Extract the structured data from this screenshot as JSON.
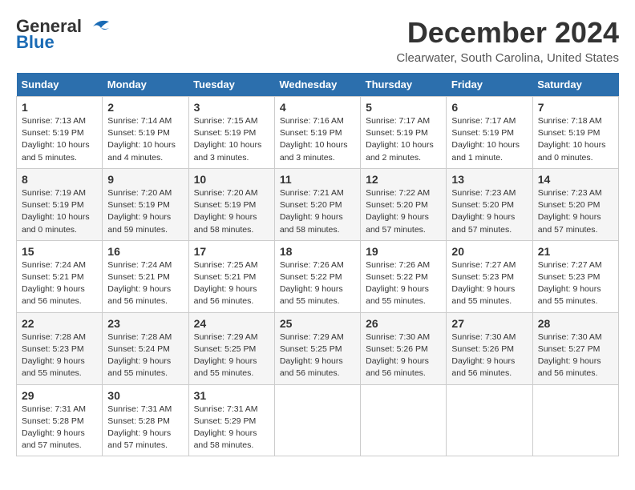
{
  "header": {
    "logo_line1": "General",
    "logo_line2": "Blue",
    "month_title": "December 2024",
    "location": "Clearwater, South Carolina, United States"
  },
  "columns": [
    "Sunday",
    "Monday",
    "Tuesday",
    "Wednesday",
    "Thursday",
    "Friday",
    "Saturday"
  ],
  "weeks": [
    [
      {
        "day": "1",
        "info": "Sunrise: 7:13 AM\nSunset: 5:19 PM\nDaylight: 10 hours\nand 5 minutes."
      },
      {
        "day": "2",
        "info": "Sunrise: 7:14 AM\nSunset: 5:19 PM\nDaylight: 10 hours\nand 4 minutes."
      },
      {
        "day": "3",
        "info": "Sunrise: 7:15 AM\nSunset: 5:19 PM\nDaylight: 10 hours\nand 3 minutes."
      },
      {
        "day": "4",
        "info": "Sunrise: 7:16 AM\nSunset: 5:19 PM\nDaylight: 10 hours\nand 3 minutes."
      },
      {
        "day": "5",
        "info": "Sunrise: 7:17 AM\nSunset: 5:19 PM\nDaylight: 10 hours\nand 2 minutes."
      },
      {
        "day": "6",
        "info": "Sunrise: 7:17 AM\nSunset: 5:19 PM\nDaylight: 10 hours\nand 1 minute."
      },
      {
        "day": "7",
        "info": "Sunrise: 7:18 AM\nSunset: 5:19 PM\nDaylight: 10 hours\nand 0 minutes."
      }
    ],
    [
      {
        "day": "8",
        "info": "Sunrise: 7:19 AM\nSunset: 5:19 PM\nDaylight: 10 hours\nand 0 minutes."
      },
      {
        "day": "9",
        "info": "Sunrise: 7:20 AM\nSunset: 5:19 PM\nDaylight: 9 hours\nand 59 minutes."
      },
      {
        "day": "10",
        "info": "Sunrise: 7:20 AM\nSunset: 5:19 PM\nDaylight: 9 hours\nand 58 minutes."
      },
      {
        "day": "11",
        "info": "Sunrise: 7:21 AM\nSunset: 5:20 PM\nDaylight: 9 hours\nand 58 minutes."
      },
      {
        "day": "12",
        "info": "Sunrise: 7:22 AM\nSunset: 5:20 PM\nDaylight: 9 hours\nand 57 minutes."
      },
      {
        "day": "13",
        "info": "Sunrise: 7:23 AM\nSunset: 5:20 PM\nDaylight: 9 hours\nand 57 minutes."
      },
      {
        "day": "14",
        "info": "Sunrise: 7:23 AM\nSunset: 5:20 PM\nDaylight: 9 hours\nand 57 minutes."
      }
    ],
    [
      {
        "day": "15",
        "info": "Sunrise: 7:24 AM\nSunset: 5:21 PM\nDaylight: 9 hours\nand 56 minutes."
      },
      {
        "day": "16",
        "info": "Sunrise: 7:24 AM\nSunset: 5:21 PM\nDaylight: 9 hours\nand 56 minutes."
      },
      {
        "day": "17",
        "info": "Sunrise: 7:25 AM\nSunset: 5:21 PM\nDaylight: 9 hours\nand 56 minutes."
      },
      {
        "day": "18",
        "info": "Sunrise: 7:26 AM\nSunset: 5:22 PM\nDaylight: 9 hours\nand 55 minutes."
      },
      {
        "day": "19",
        "info": "Sunrise: 7:26 AM\nSunset: 5:22 PM\nDaylight: 9 hours\nand 55 minutes."
      },
      {
        "day": "20",
        "info": "Sunrise: 7:27 AM\nSunset: 5:23 PM\nDaylight: 9 hours\nand 55 minutes."
      },
      {
        "day": "21",
        "info": "Sunrise: 7:27 AM\nSunset: 5:23 PM\nDaylight: 9 hours\nand 55 minutes."
      }
    ],
    [
      {
        "day": "22",
        "info": "Sunrise: 7:28 AM\nSunset: 5:23 PM\nDaylight: 9 hours\nand 55 minutes."
      },
      {
        "day": "23",
        "info": "Sunrise: 7:28 AM\nSunset: 5:24 PM\nDaylight: 9 hours\nand 55 minutes."
      },
      {
        "day": "24",
        "info": "Sunrise: 7:29 AM\nSunset: 5:25 PM\nDaylight: 9 hours\nand 55 minutes."
      },
      {
        "day": "25",
        "info": "Sunrise: 7:29 AM\nSunset: 5:25 PM\nDaylight: 9 hours\nand 56 minutes."
      },
      {
        "day": "26",
        "info": "Sunrise: 7:30 AM\nSunset: 5:26 PM\nDaylight: 9 hours\nand 56 minutes."
      },
      {
        "day": "27",
        "info": "Sunrise: 7:30 AM\nSunset: 5:26 PM\nDaylight: 9 hours\nand 56 minutes."
      },
      {
        "day": "28",
        "info": "Sunrise: 7:30 AM\nSunset: 5:27 PM\nDaylight: 9 hours\nand 56 minutes."
      }
    ],
    [
      {
        "day": "29",
        "info": "Sunrise: 7:31 AM\nSunset: 5:28 PM\nDaylight: 9 hours\nand 57 minutes."
      },
      {
        "day": "30",
        "info": "Sunrise: 7:31 AM\nSunset: 5:28 PM\nDaylight: 9 hours\nand 57 minutes."
      },
      {
        "day": "31",
        "info": "Sunrise: 7:31 AM\nSunset: 5:29 PM\nDaylight: 9 hours\nand 58 minutes."
      },
      {
        "day": "",
        "info": ""
      },
      {
        "day": "",
        "info": ""
      },
      {
        "day": "",
        "info": ""
      },
      {
        "day": "",
        "info": ""
      }
    ]
  ]
}
